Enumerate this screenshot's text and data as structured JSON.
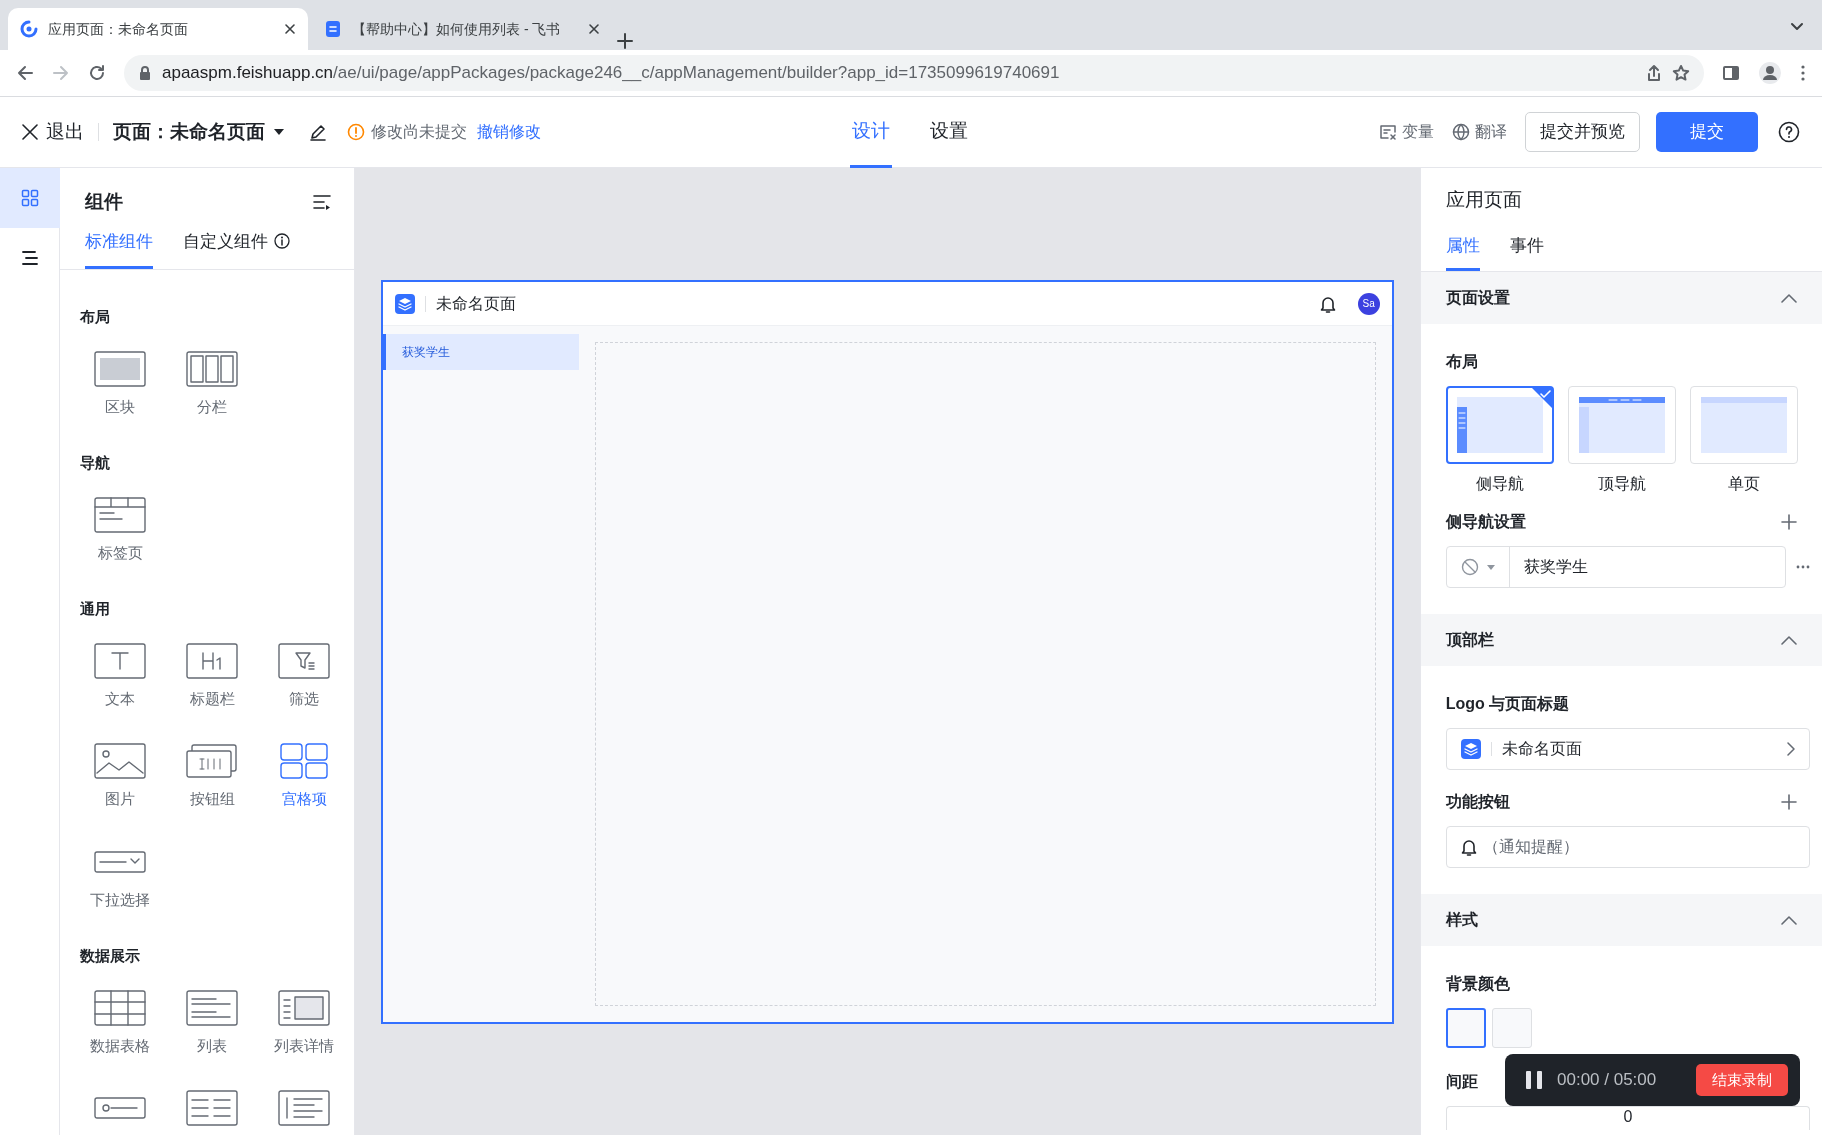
{
  "browser": {
    "tabs": [
      {
        "title": "应用页面：未命名页面",
        "selected": true,
        "kind": "app"
      },
      {
        "title": "【帮助中心】如何使用列表 - 飞书",
        "selected": false,
        "kind": "doc"
      }
    ],
    "url_host": "apaaspm.feishuapp.cn",
    "url_path": "/ae/ui/page/appPackages/package246__c/appManagement/builder?app_id=1735099619740691"
  },
  "header": {
    "exit": "退出",
    "page_selector": "页面：未命名页面",
    "status": "修改尚未提交",
    "undo": "撤销修改",
    "mode_tabs": [
      {
        "label": "设计",
        "selected": true
      },
      {
        "label": "设置",
        "selected": false
      }
    ],
    "tools": [
      {
        "label": "变量",
        "kind": "variable"
      },
      {
        "label": "翻译",
        "kind": "globe"
      }
    ],
    "preview_button": "提交并预览",
    "submit_button": "提交"
  },
  "rail": [
    {
      "kind": "grid",
      "selected": true
    },
    {
      "kind": "outline",
      "selected": false
    }
  ],
  "components": {
    "title": "组件",
    "tabs": [
      {
        "label": "标准组件",
        "selected": true
      },
      {
        "label": "自定义组件",
        "selected": false
      }
    ],
    "groups": [
      {
        "title": "布局",
        "items": [
          {
            "label": "区块",
            "kind": "block",
            "selected": false
          },
          {
            "label": "分栏",
            "kind": "columns",
            "selected": false
          }
        ]
      },
      {
        "title": "导航",
        "items": [
          {
            "label": "标签页",
            "kind": "tabs",
            "selected": false
          }
        ]
      },
      {
        "title": "通用",
        "items": [
          {
            "label": "文本",
            "kind": "text",
            "selected": false
          },
          {
            "label": "标题栏",
            "kind": "heading",
            "selected": false
          },
          {
            "label": "筛选",
            "kind": "filter",
            "selected": false
          },
          {
            "label": "图片",
            "kind": "image",
            "selected": false
          },
          {
            "label": "按钮组",
            "kind": "buttons",
            "selected": false
          },
          {
            "label": "宫格项",
            "kind": "grid",
            "selected": true
          },
          {
            "label": "下拉选择",
            "kind": "select",
            "selected": false
          }
        ]
      },
      {
        "title": "数据展示",
        "items": [
          {
            "label": "数据表格",
            "kind": "table",
            "selected": false
          },
          {
            "label": "列表",
            "kind": "list",
            "selected": false
          },
          {
            "label": "列表详情",
            "kind": "listdetail",
            "selected": false
          },
          {
            "kind": "detail1",
            "selected": false
          },
          {
            "kind": "detail2",
            "selected": false
          },
          {
            "kind": "detail3",
            "selected": false
          }
        ]
      }
    ]
  },
  "canvas": {
    "app_title": "未命名页面",
    "avatar": "Sa",
    "nav_items": [
      {
        "label": "获奖学生",
        "selected": true
      }
    ]
  },
  "properties": {
    "title": "应用页面",
    "tabs": [
      {
        "label": "属性",
        "selected": true
      },
      {
        "label": "事件",
        "selected": false
      }
    ],
    "page_settings": {
      "title": "页面设置",
      "layout_label": "布局",
      "layouts": [
        {
          "label": "侧导航",
          "kind": "side",
          "selected": true
        },
        {
          "label": "顶导航",
          "kind": "top",
          "selected": false
        },
        {
          "label": "单页",
          "kind": "single",
          "selected": false
        }
      ],
      "side_nav_label": "侧导航设置",
      "side_nav_items": [
        {
          "label": "获奖学生"
        }
      ]
    },
    "top_bar": {
      "title": "顶部栏",
      "logo_label": "Logo 与页面标题",
      "logo_title": "未命名页面",
      "buttons_label": "功能按钮",
      "buttons": [
        {
          "label": "（通知提醒）"
        }
      ]
    },
    "style": {
      "title": "样式",
      "bg_label": "背景颜色",
      "swatches": [
        {
          "selected": true
        },
        {
          "selected": false
        }
      ],
      "spacing_label": "间距",
      "spacing_value": "0"
    }
  },
  "recorder": {
    "time": "00:00 / 05:00",
    "stop": "结束录制"
  }
}
